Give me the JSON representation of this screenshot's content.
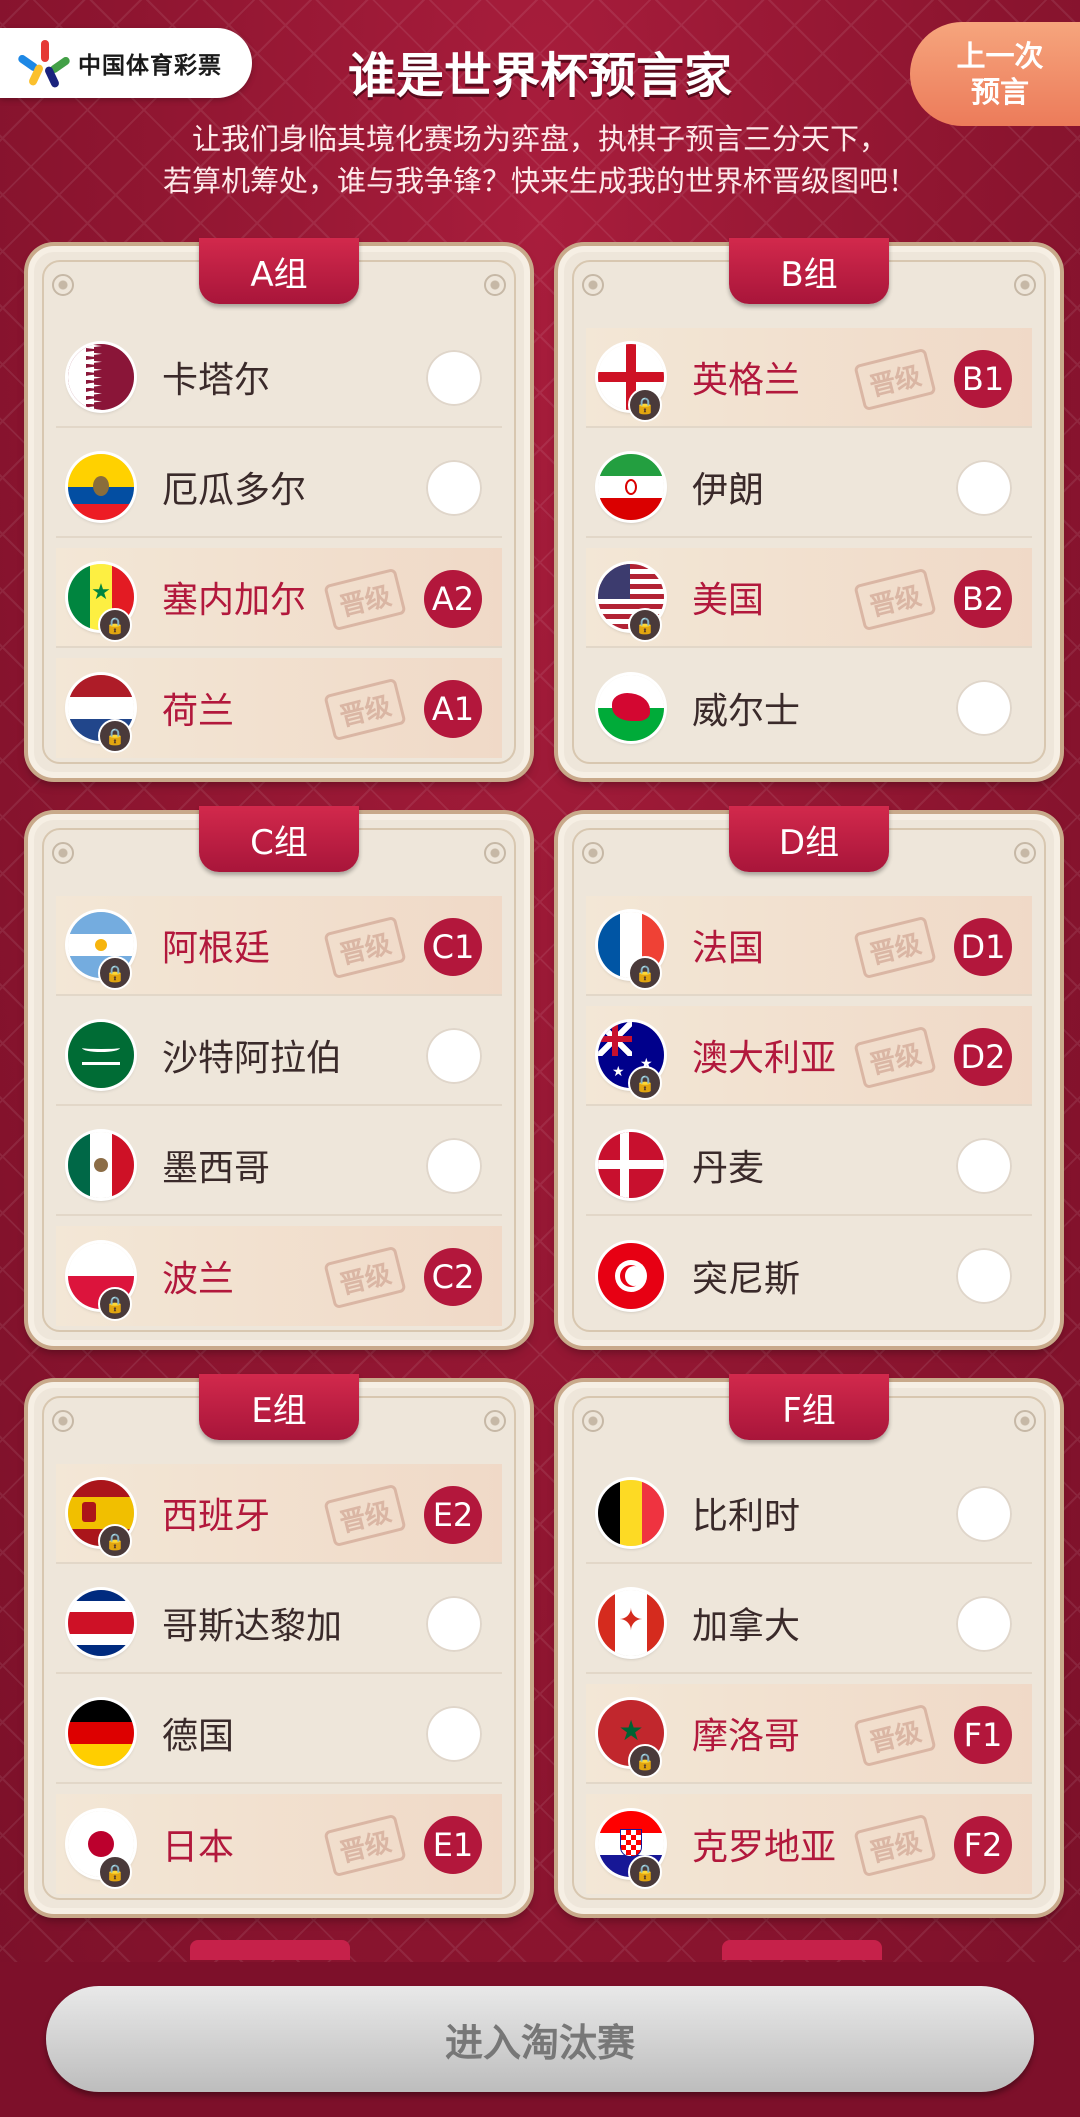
{
  "header": {
    "brand": "中国体育彩票",
    "title": "谁是世界杯预言家",
    "last_btn_line1": "上一次",
    "last_btn_line2": "预言",
    "subtitle_line1": "让我们身临其境化赛场为弈盘，执棋子预言三分天下，",
    "subtitle_line2": "若算机筹处，谁与我争锋？快来生成我的世界杯晋级图吧！"
  },
  "stamp_text": "晋级",
  "lock_icon": "lock-icon",
  "groups": [
    {
      "label": "A组",
      "teams": [
        {
          "name": "卡塔尔",
          "flag": "qatar",
          "advanced": false,
          "badge": ""
        },
        {
          "name": "厄瓜多尔",
          "flag": "ecuador",
          "advanced": false,
          "badge": ""
        },
        {
          "name": "塞内加尔",
          "flag": "senegal",
          "advanced": true,
          "badge": "A2"
        },
        {
          "name": "荷兰",
          "flag": "netherlands",
          "advanced": true,
          "badge": "A1"
        }
      ]
    },
    {
      "label": "B组",
      "teams": [
        {
          "name": "英格兰",
          "flag": "england",
          "advanced": true,
          "badge": "B1"
        },
        {
          "name": "伊朗",
          "flag": "iran",
          "advanced": false,
          "badge": ""
        },
        {
          "name": "美国",
          "flag": "usa",
          "advanced": true,
          "badge": "B2"
        },
        {
          "name": "威尔士",
          "flag": "wales",
          "advanced": false,
          "badge": ""
        }
      ]
    },
    {
      "label": "C组",
      "teams": [
        {
          "name": "阿根廷",
          "flag": "argentina",
          "advanced": true,
          "badge": "C1"
        },
        {
          "name": "沙特阿拉伯",
          "flag": "saudi",
          "advanced": false,
          "badge": ""
        },
        {
          "name": "墨西哥",
          "flag": "mexico",
          "advanced": false,
          "badge": ""
        },
        {
          "name": "波兰",
          "flag": "poland",
          "advanced": true,
          "badge": "C2"
        }
      ]
    },
    {
      "label": "D组",
      "teams": [
        {
          "name": "法国",
          "flag": "france",
          "advanced": true,
          "badge": "D1"
        },
        {
          "name": "澳大利亚",
          "flag": "australia",
          "advanced": true,
          "badge": "D2"
        },
        {
          "name": "丹麦",
          "flag": "denmark",
          "advanced": false,
          "badge": ""
        },
        {
          "name": "突尼斯",
          "flag": "tunisia",
          "advanced": false,
          "badge": ""
        }
      ]
    },
    {
      "label": "E组",
      "teams": [
        {
          "name": "西班牙",
          "flag": "spain",
          "advanced": true,
          "badge": "E2"
        },
        {
          "name": "哥斯达黎加",
          "flag": "costarica",
          "advanced": false,
          "badge": ""
        },
        {
          "name": "德国",
          "flag": "germany",
          "advanced": false,
          "badge": ""
        },
        {
          "name": "日本",
          "flag": "japan",
          "advanced": true,
          "badge": "E1"
        }
      ]
    },
    {
      "label": "F组",
      "teams": [
        {
          "name": "比利时",
          "flag": "belgium",
          "advanced": false,
          "badge": ""
        },
        {
          "name": "加拿大",
          "flag": "canada",
          "advanced": false,
          "badge": ""
        },
        {
          "name": "摩洛哥",
          "flag": "morocco",
          "advanced": true,
          "badge": "F1"
        },
        {
          "name": "克罗地亚",
          "flag": "croatia",
          "advanced": true,
          "badge": "F2"
        }
      ]
    }
  ],
  "footer": {
    "enter_label": "进入淘汰赛"
  }
}
